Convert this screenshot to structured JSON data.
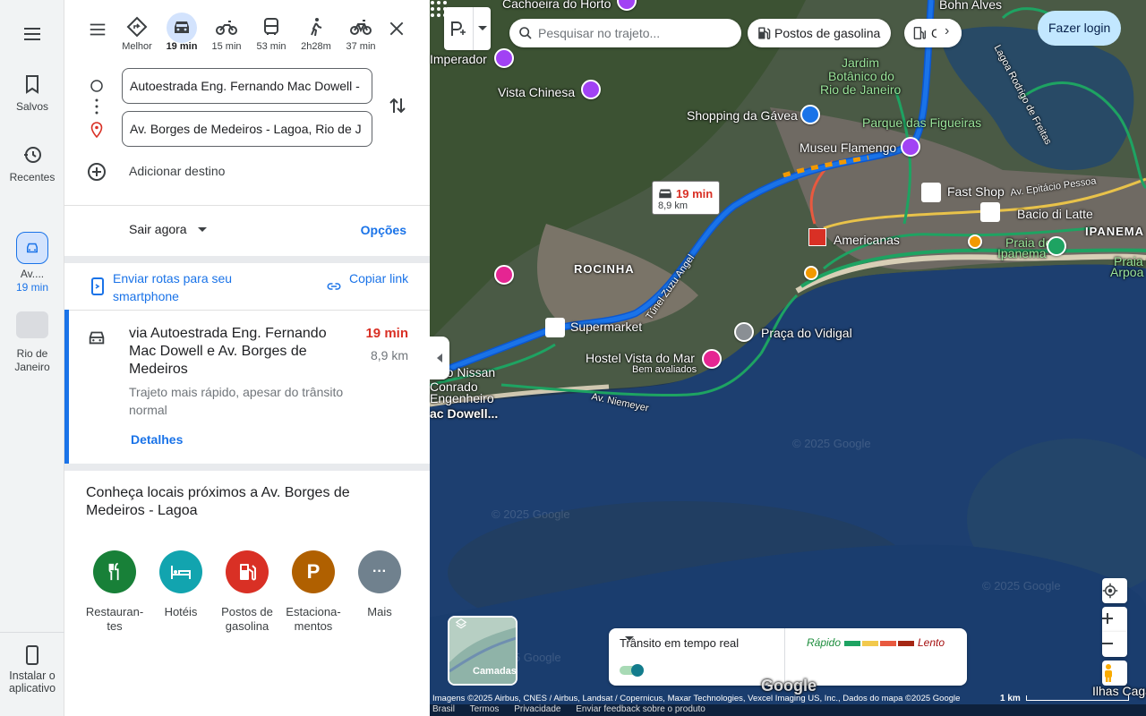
{
  "rail": {
    "menu_icon": "menu-icon",
    "saved": "Salvos",
    "recent": "Recentes",
    "current_trip": "Av.... 19 min",
    "current_trip_line1": "Av....",
    "current_trip_line2": "19 min",
    "place": "Rio de Janeiro",
    "place_line1": "Rio de",
    "place_line2": "Janeiro",
    "install": "Instalar o aplicativo",
    "install_line1": "Instalar o",
    "install_line2": "aplicativo"
  },
  "modes": [
    {
      "name": "best",
      "label": "Melhor",
      "icon": "route-diamond-icon"
    },
    {
      "name": "car",
      "label": "19 min",
      "icon": "car-icon",
      "active": true
    },
    {
      "name": "motorcycle",
      "label": "15 min",
      "icon": "motorcycle-icon"
    },
    {
      "name": "transit",
      "label": "53 min",
      "icon": "bus-icon"
    },
    {
      "name": "walk",
      "label": "2h28m",
      "icon": "walk-icon"
    },
    {
      "name": "bike",
      "label": "37 min",
      "icon": "bike-icon"
    }
  ],
  "directions": {
    "origin": "Autoestrada Eng. Fernando Mac Dowell - ",
    "destination": "Av. Borges de Medeiros - Lagoa, Rio de J",
    "add_destination": "Adicionar destino",
    "leave_now": "Sair agora",
    "options": "Opções",
    "send_to_phone": "Enviar rotas para seu smartphone",
    "copy_link": "Copiar link"
  },
  "route": {
    "title": "via Autoestrada Eng. Fernando Mac Dowell e Av. Borges de Medeiros",
    "time": "19 min",
    "distance": "8,9 km",
    "subtitle": "Trajeto mais rápido, apesar do trânsito normal",
    "details": "Detalhes"
  },
  "nearby": {
    "title": "Conheça locais próximos a Av. Borges de Medeiros - Lagoa",
    "categories": [
      {
        "label": "Restaurantes",
        "label_l1": "Restauran-",
        "label_l2": "tes",
        "color": "#188038",
        "icon": "restaurant-icon"
      },
      {
        "label": "Hotéis",
        "label_l1": "Hotéis",
        "label_l2": "",
        "color": "#12a4af",
        "icon": "hotel-icon"
      },
      {
        "label": "Postos de gasolina",
        "label_l1": "Postos de",
        "label_l2": "gasolina",
        "color": "#d93025",
        "icon": "gas-station-icon"
      },
      {
        "label": "Estacionamentos",
        "label_l1": "Estaciona-",
        "label_l2": "mentos",
        "color": "#b06000",
        "icon": "parking-icon",
        "glyph": "P"
      },
      {
        "label": "Mais",
        "label_l1": "Mais",
        "label_l2": "",
        "color": "#70818e",
        "icon": "more-icon",
        "glyph": "···"
      }
    ]
  },
  "map": {
    "search_placeholder": "Pesquisar no trajeto...",
    "chip_gas": "Postos de gasolina",
    "chip_ev": "C",
    "login": "Fazer login",
    "route_time": "19 min",
    "route_distance": "8,9 km",
    "labels": {
      "cachoeira": "Cachoeira do Horto",
      "bohn": "Bohn Alves",
      "imperador": "Imperador",
      "jardim1": "Jardim",
      "jardim2": "Botânico do",
      "jardim3": "Rio de Janeiro",
      "vista_chinesa": "Vista Chinesa",
      "shopping_gavea": "Shopping da Gávea",
      "parque": "Parque das Figueiras",
      "museu": "Museu Flamengo",
      "fast_shop": "Fast Shop",
      "av_epitacio": "Av. Epitácio Pessoa",
      "bacio": "Bacio di Latte",
      "americanas": "Americanas",
      "rocinha": "ROCINHA",
      "praia1": "Praia de",
      "praia2": "Ipanema",
      "ipanema": "IPANEMA",
      "arpoador1": "Praia do",
      "arpoador2": "Arpoa",
      "supermarket": "Supermarket",
      "tunel": "Túnel Zuzu Angel",
      "vidigal": "Praça do Vidigal",
      "hostel": "Hostel Vista do Mar",
      "hostel_sub": "Bem avaliados",
      "nissan": "iego Nissan",
      "conrado": "Conrado",
      "engenheiro": "Engenheiro",
      "macdowell": "ac Dowell...",
      "niemeyer": "Av. Niemeyer",
      "lagoa": "Lagoa Rodrigo de Freitas",
      "ilhas": "Ilhas Cagarr"
    },
    "watermark": "© 2025 Google",
    "layers": "Camadas",
    "traffic_label": "Trânsito em tempo real",
    "traffic_fast": "Rápido",
    "traffic_slow": "Lento",
    "traffic_colors": [
      "#1ea362",
      "#f2c94c",
      "#e8593f",
      "#a52714"
    ],
    "attribution": "Imagens ©2025 Airbus, CNES / Airbus, Landsat / Copernicus, Maxar Technologies, Vexcel Imaging US, Inc., Dados do mapa ©2025 Google",
    "scale": "1 km",
    "footer": [
      "Brasil",
      "Termos",
      "Privacidade",
      "Enviar feedback sobre o produto"
    ],
    "google_logo": "Google"
  }
}
